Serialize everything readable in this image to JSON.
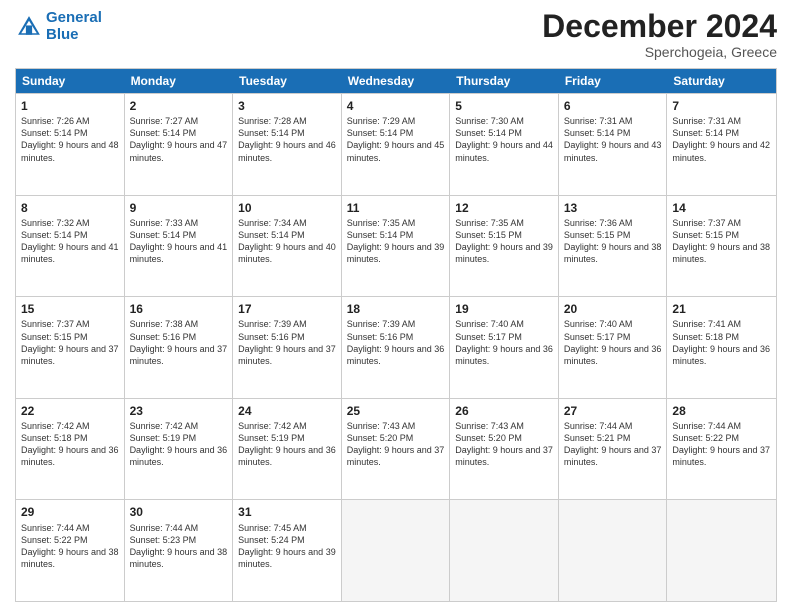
{
  "header": {
    "logo_line1": "General",
    "logo_line2": "Blue",
    "month_title": "December 2024",
    "location": "Sperchogeia, Greece"
  },
  "days_of_week": [
    "Sunday",
    "Monday",
    "Tuesday",
    "Wednesday",
    "Thursday",
    "Friday",
    "Saturday"
  ],
  "weeks": [
    [
      {
        "day": "1",
        "sunrise": "7:26 AM",
        "sunset": "5:14 PM",
        "daylight": "9 hours and 48 minutes."
      },
      {
        "day": "2",
        "sunrise": "7:27 AM",
        "sunset": "5:14 PM",
        "daylight": "9 hours and 47 minutes."
      },
      {
        "day": "3",
        "sunrise": "7:28 AM",
        "sunset": "5:14 PM",
        "daylight": "9 hours and 46 minutes."
      },
      {
        "day": "4",
        "sunrise": "7:29 AM",
        "sunset": "5:14 PM",
        "daylight": "9 hours and 45 minutes."
      },
      {
        "day": "5",
        "sunrise": "7:30 AM",
        "sunset": "5:14 PM",
        "daylight": "9 hours and 44 minutes."
      },
      {
        "day": "6",
        "sunrise": "7:31 AM",
        "sunset": "5:14 PM",
        "daylight": "9 hours and 43 minutes."
      },
      {
        "day": "7",
        "sunrise": "7:31 AM",
        "sunset": "5:14 PM",
        "daylight": "9 hours and 42 minutes."
      }
    ],
    [
      {
        "day": "8",
        "sunrise": "7:32 AM",
        "sunset": "5:14 PM",
        "daylight": "9 hours and 41 minutes."
      },
      {
        "day": "9",
        "sunrise": "7:33 AM",
        "sunset": "5:14 PM",
        "daylight": "9 hours and 41 minutes."
      },
      {
        "day": "10",
        "sunrise": "7:34 AM",
        "sunset": "5:14 PM",
        "daylight": "9 hours and 40 minutes."
      },
      {
        "day": "11",
        "sunrise": "7:35 AM",
        "sunset": "5:14 PM",
        "daylight": "9 hours and 39 minutes."
      },
      {
        "day": "12",
        "sunrise": "7:35 AM",
        "sunset": "5:15 PM",
        "daylight": "9 hours and 39 minutes."
      },
      {
        "day": "13",
        "sunrise": "7:36 AM",
        "sunset": "5:15 PM",
        "daylight": "9 hours and 38 minutes."
      },
      {
        "day": "14",
        "sunrise": "7:37 AM",
        "sunset": "5:15 PM",
        "daylight": "9 hours and 38 minutes."
      }
    ],
    [
      {
        "day": "15",
        "sunrise": "7:37 AM",
        "sunset": "5:15 PM",
        "daylight": "9 hours and 37 minutes."
      },
      {
        "day": "16",
        "sunrise": "7:38 AM",
        "sunset": "5:16 PM",
        "daylight": "9 hours and 37 minutes."
      },
      {
        "day": "17",
        "sunrise": "7:39 AM",
        "sunset": "5:16 PM",
        "daylight": "9 hours and 37 minutes."
      },
      {
        "day": "18",
        "sunrise": "7:39 AM",
        "sunset": "5:16 PM",
        "daylight": "9 hours and 36 minutes."
      },
      {
        "day": "19",
        "sunrise": "7:40 AM",
        "sunset": "5:17 PM",
        "daylight": "9 hours and 36 minutes."
      },
      {
        "day": "20",
        "sunrise": "7:40 AM",
        "sunset": "5:17 PM",
        "daylight": "9 hours and 36 minutes."
      },
      {
        "day": "21",
        "sunrise": "7:41 AM",
        "sunset": "5:18 PM",
        "daylight": "9 hours and 36 minutes."
      }
    ],
    [
      {
        "day": "22",
        "sunrise": "7:42 AM",
        "sunset": "5:18 PM",
        "daylight": "9 hours and 36 minutes."
      },
      {
        "day": "23",
        "sunrise": "7:42 AM",
        "sunset": "5:19 PM",
        "daylight": "9 hours and 36 minutes."
      },
      {
        "day": "24",
        "sunrise": "7:42 AM",
        "sunset": "5:19 PM",
        "daylight": "9 hours and 36 minutes."
      },
      {
        "day": "25",
        "sunrise": "7:43 AM",
        "sunset": "5:20 PM",
        "daylight": "9 hours and 37 minutes."
      },
      {
        "day": "26",
        "sunrise": "7:43 AM",
        "sunset": "5:20 PM",
        "daylight": "9 hours and 37 minutes."
      },
      {
        "day": "27",
        "sunrise": "7:44 AM",
        "sunset": "5:21 PM",
        "daylight": "9 hours and 37 minutes."
      },
      {
        "day": "28",
        "sunrise": "7:44 AM",
        "sunset": "5:22 PM",
        "daylight": "9 hours and 37 minutes."
      }
    ],
    [
      {
        "day": "29",
        "sunrise": "7:44 AM",
        "sunset": "5:22 PM",
        "daylight": "9 hours and 38 minutes."
      },
      {
        "day": "30",
        "sunrise": "7:44 AM",
        "sunset": "5:23 PM",
        "daylight": "9 hours and 38 minutes."
      },
      {
        "day": "31",
        "sunrise": "7:45 AM",
        "sunset": "5:24 PM",
        "daylight": "9 hours and 39 minutes."
      },
      null,
      null,
      null,
      null
    ]
  ],
  "labels": {
    "sunrise": "Sunrise:",
    "sunset": "Sunset:",
    "daylight": "Daylight:"
  }
}
